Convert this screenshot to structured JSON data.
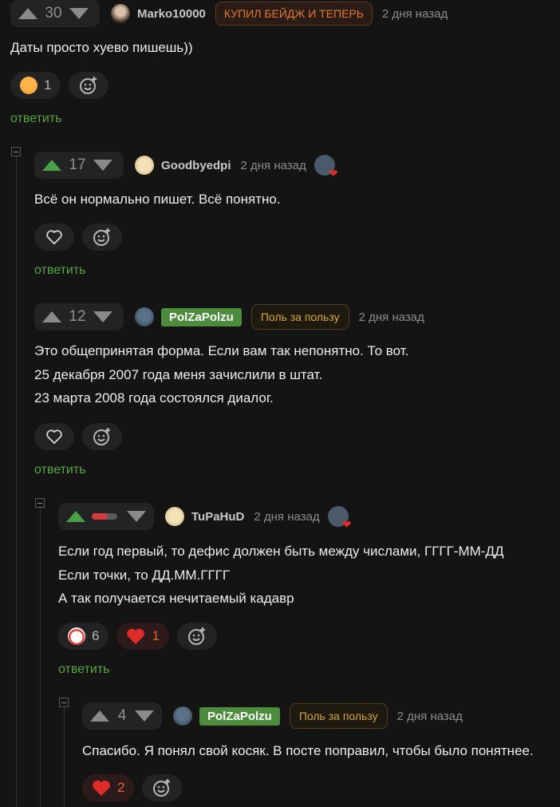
{
  "comments": [
    {
      "rating": "30",
      "author": "Marko10000",
      "badge": "КУПИЛ БЕЙДЖ И ТЕПЕРЬ",
      "time": "2 дня назад",
      "lines": [
        "Даты просто хуево пишешь))"
      ],
      "reactions": [
        {
          "emoji": "laughing-face",
          "count": "1"
        }
      ],
      "reply": "ответить"
    },
    {
      "rating": "17",
      "author": "Goodbyedpi",
      "time": "2 дня назад",
      "lines": [
        "Всё он нормально пишет. Всё понятно."
      ],
      "reply": "ответить"
    },
    {
      "rating": "12",
      "author": "PolZaPolzu",
      "badge": "Поль за пользу",
      "time": "2 дня назад",
      "lines": [
        "Это общепринятая форма. Если вам так непонятно. То вот.",
        "25 декабря 2007 года меня зачислили в штат.",
        "23 марта 2008 года состоялся диалог."
      ],
      "reply": "ответить"
    },
    {
      "rating": "",
      "rating_bar_fill": 0.6,
      "author": "TuPaHuD",
      "time": "2 дня назад",
      "lines": [
        "Если год первый, то дефис должен быть между числами, ГГГГ-ММ-ДД",
        "Если точки, то ДД.ММ.ГГГГ",
        "А так получается нечитаемый кадавр"
      ],
      "reactions": [
        {
          "emoji": "clown-face",
          "count": "6"
        },
        {
          "emoji": "heart",
          "count": "1"
        }
      ],
      "reply": "ответить"
    },
    {
      "rating": "4",
      "author": "PolZaPolzu",
      "badge": "Поль за пользу",
      "time": "2 дня назад",
      "lines": [
        "Спасибо. Я понял свой косяк. В посте поправил, чтобы было понятнее."
      ],
      "reactions": [
        {
          "emoji": "heart",
          "count": "2"
        }
      ]
    }
  ],
  "colors": {
    "background": "#141414",
    "upvote_active": "#4aa046",
    "reply_link": "#5aa446",
    "author_badge": "#4c8c3c",
    "heart": "#e02b2b"
  }
}
